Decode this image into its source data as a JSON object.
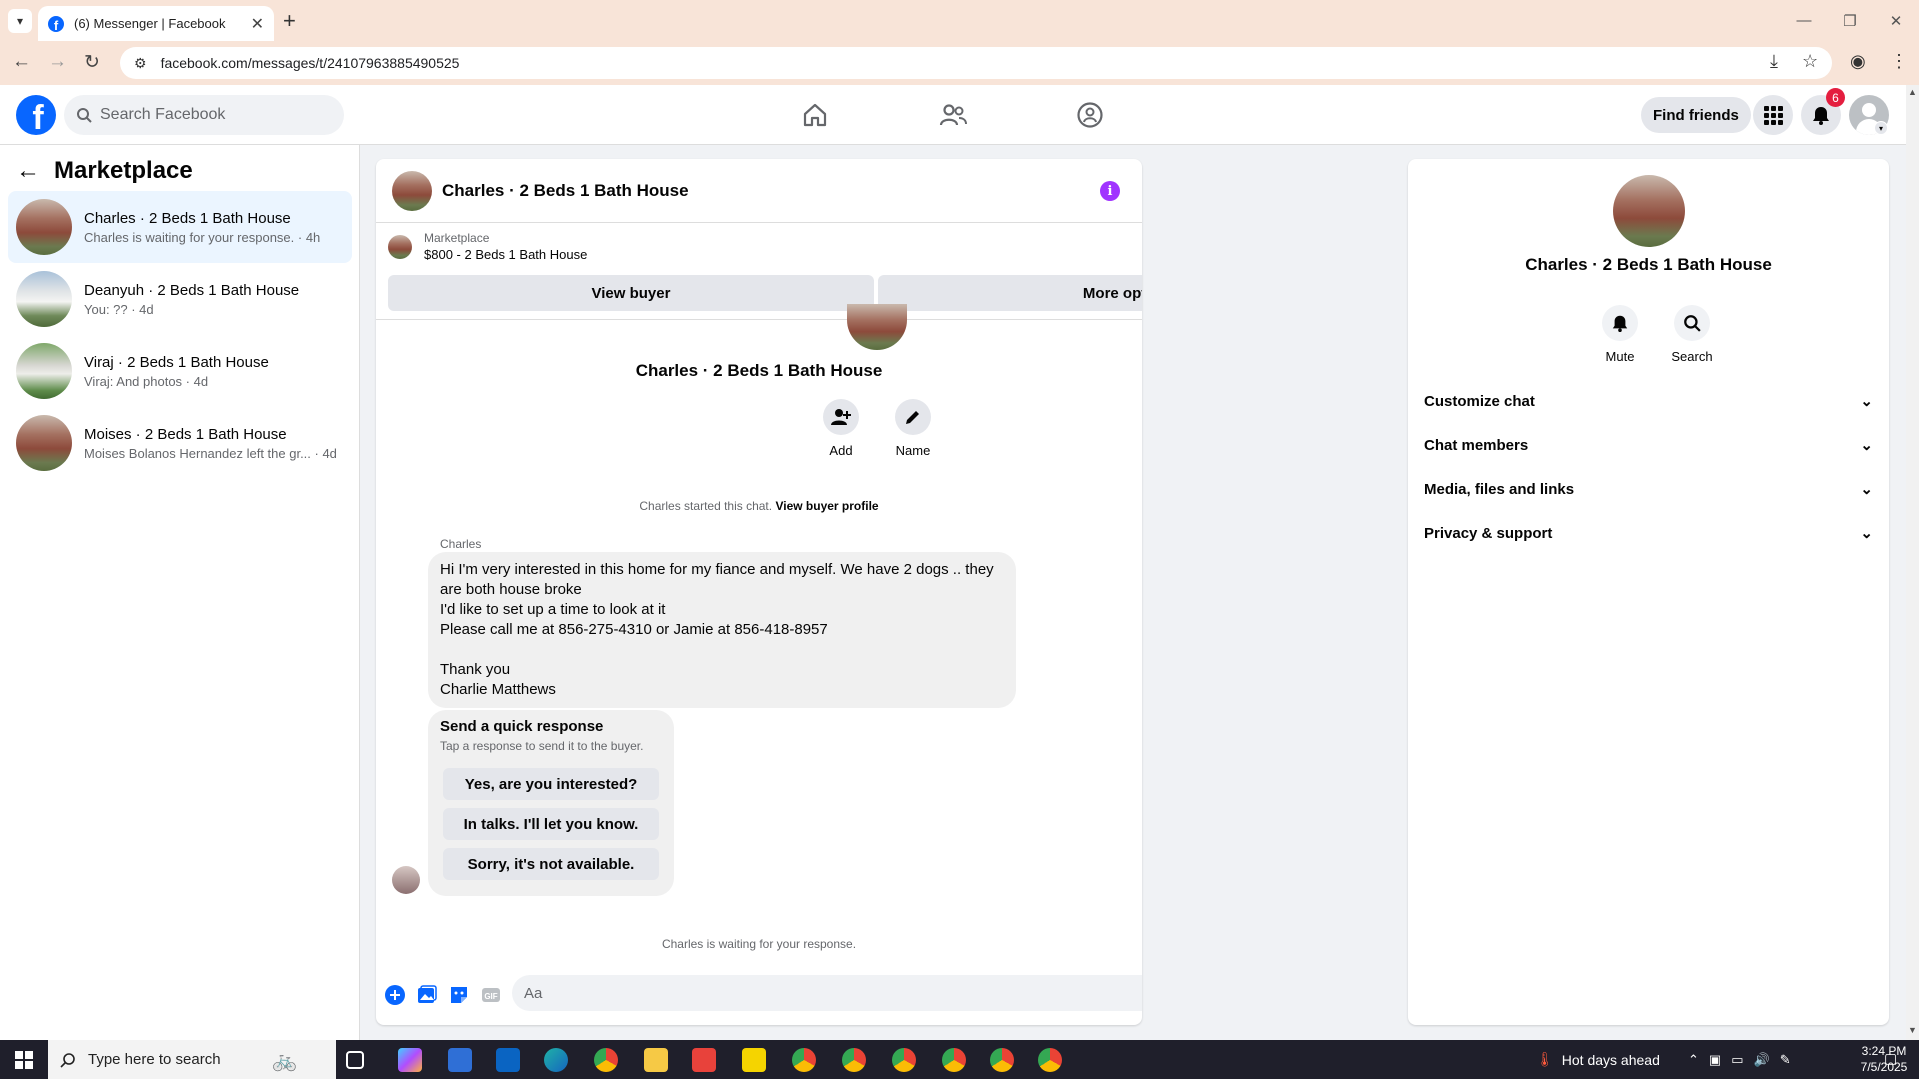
{
  "browser": {
    "tab_title": "(6) Messenger | Facebook",
    "url": "facebook.com/messages/t/24107963885490525"
  },
  "header": {
    "search_placeholder": "Search Facebook",
    "find_friends": "Find friends",
    "notification_count": "6",
    "brand_color": "#0866ff"
  },
  "sidebar": {
    "title": "Marketplace",
    "conversations": [
      {
        "name": "Charles · 2 Beds 1 Bath House",
        "preview": "Charles is waiting for your response. · 4h",
        "active": true
      },
      {
        "name": "Deanyuh · 2 Beds 1 Bath House",
        "preview": "You: ?? · 4d",
        "active": false
      },
      {
        "name": "Viraj · 2 Beds 1 Bath House",
        "preview": "Viraj: And photos · 4d",
        "active": false
      },
      {
        "name": "Moises · 2 Beds 1 Bath House",
        "preview": "Moises Bolanos Hernandez left the gr... · 4d",
        "active": false
      }
    ]
  },
  "chat": {
    "title": "Charles · 2 Beds 1 Bath House",
    "marketplace_label": "Marketplace",
    "listing": "$800 - 2 Beds 1 Bath House",
    "view_buyer": "View buyer",
    "more_options": "More options",
    "profile_name": "Charles · 2 Beds 1 Bath House",
    "add_label": "Add",
    "name_label": "Name",
    "started_text": "Charles started this chat.",
    "view_buyer_profile": "View buyer profile",
    "sender": "Charles",
    "message": "Hi I'm very interested in this home for my fiance and myself. We have 2 dogs .. they are both house broke\nI'd like to set up a time to look at it\nPlease call me at 856-275-4310 or Jamie at 856-418-8957\n\nThank you\nCharlie Matthews",
    "quick_title": "Send a quick response",
    "quick_sub": "Tap a response to send it to the buyer.",
    "quick_responses": [
      "Yes, are you interested?",
      "In talks. I'll let you know.",
      "Sorry, it's not available."
    ],
    "waiting": "Charles is waiting for your response.",
    "composer_placeholder": "Aa",
    "accent_color": "#a033ff"
  },
  "info_panel": {
    "name": "Charles · 2 Beds 1 Bath House",
    "mute": "Mute",
    "search": "Search",
    "sections": [
      "Customize chat",
      "Chat members",
      "Media, files and links",
      "Privacy & support"
    ]
  },
  "taskbar": {
    "search_placeholder": "Type here to search",
    "weather": "Hot days ahead",
    "time": "3:24 PM",
    "date": "7/5/2025"
  }
}
